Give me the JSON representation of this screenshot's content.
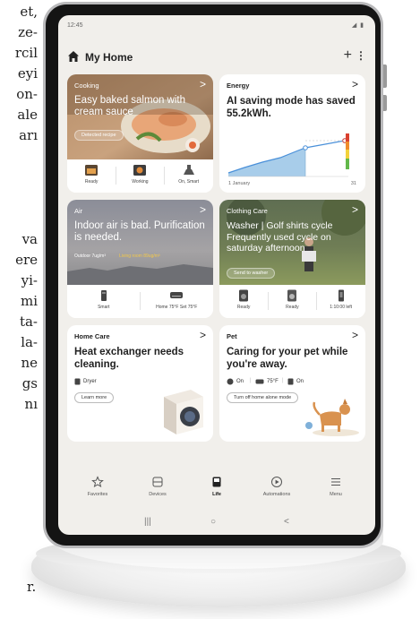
{
  "left_text_top": [
    "et,",
    "ze-",
    "rcil",
    "eyi",
    "on-",
    "ale",
    "arı"
  ],
  "left_text_mid": [
    "va",
    "ere",
    "yi-",
    "mi",
    "ta-",
    "la-",
    "ne",
    "gs",
    "nı"
  ],
  "left_text_bottom": "r.",
  "status": {
    "time": "12:45",
    "icons": "◢ ▮"
  },
  "header": {
    "title": "My Home",
    "add": "+",
    "more": "⋮"
  },
  "cards": {
    "cooking": {
      "title": "Cooking",
      "chevron": ">",
      "text": "Easy baked salmon with cream sauce",
      "button": "Detected recipe",
      "devices": [
        {
          "icon": "oven-icon",
          "label": "Ready"
        },
        {
          "icon": "cooktop-icon",
          "label": "Working"
        },
        {
          "icon": "hood-icon",
          "label": "On, Smart"
        }
      ]
    },
    "energy": {
      "title": "Energy",
      "chevron": ">",
      "text": "AI saving mode has saved 55.2kWh.",
      "date_start": "1 January",
      "date_end": "31"
    },
    "air": {
      "title": "Air",
      "chevron": ">",
      "text": "Indoor air is bad. Purification is needed.",
      "sub_outdoor": "Outdoor 7ug/m³",
      "sub_living": "Living room 89ug/m³",
      "devices": [
        {
          "icon": "purifier-icon",
          "label": "Smart"
        },
        {
          "icon": "ac-icon",
          "label": "Home 75°F Set 75°F"
        }
      ]
    },
    "clothing": {
      "title": "Clothing Care",
      "chevron": ">",
      "text": "Washer | Golf shirts cycle Frequently used cycle on saturday afternoon",
      "button": "Send to washer",
      "devices": [
        {
          "icon": "washer-icon",
          "label": "Ready"
        },
        {
          "icon": "dryer-icon",
          "label": "Ready"
        },
        {
          "icon": "styler-icon",
          "label": "1:10:00 left"
        }
      ]
    },
    "homecare": {
      "title": "Home Care",
      "chevron": ">",
      "text": "Heat exchanger needs cleaning.",
      "device": "Dryer",
      "button": "Learn more"
    },
    "pet": {
      "title": "Pet",
      "chevron": ">",
      "text": "Caring for your pet while you're away.",
      "status1": "On",
      "status2": "75°F",
      "status3": "On",
      "button": "Turn off home alone mode"
    }
  },
  "nav": {
    "items": [
      {
        "label": "Favorites",
        "icon": "star-icon"
      },
      {
        "label": "Devices",
        "icon": "devices-icon"
      },
      {
        "label": "Life",
        "icon": "life-icon"
      },
      {
        "label": "Automations",
        "icon": "automations-icon"
      },
      {
        "label": "Menu",
        "icon": "menu-icon"
      }
    ],
    "active": "Life"
  },
  "sysnav": {
    "recent": "|||",
    "home": "○",
    "back": "<"
  }
}
